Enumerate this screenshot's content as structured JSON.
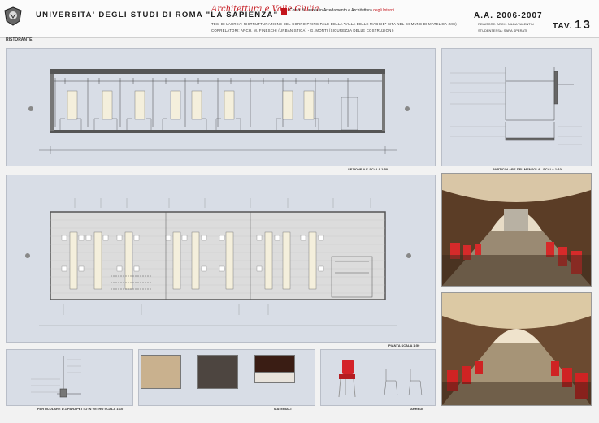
{
  "header": {
    "university": "UNIVERSITA' DEGLI STUDI DI ROMA \"LA SAPIENZA\"",
    "brand_script": "Architettura e Valle Giulia",
    "course_prefix": "Corso di Laurea in Arredamento e Architettura",
    "course_accent": "degli Interni",
    "thesis_line": "TESI DI LAUREA: RISTRUTTURAZIONE DEL CORPO PRINCIPALE DELLA \"VILLA DELLE MAGGIE\" SITA NEL COMUNE DI MATELICA (MC)",
    "correlatori_line": "CORRELATORI: ARCH. M. FINESCHI (URBANISTICA) - G. MONTI (SICUREZZA DELLE COSTRUZIONI)",
    "academic_year": "A.A. 2006-2007",
    "relatori": "RELATORE: ARCH. NILDA VALENTIN",
    "studenti": "STUDENTESSA: SARA SPERATI",
    "tav_label": "TAV.",
    "tav_number": "13"
  },
  "section_title": "RISTORANTE",
  "panels": {
    "sezione": "SEZIONE AA' SCALA 1:50",
    "mensola": "PARTICOLARE DEL MENSOLA - SCALA 1:10",
    "pianta": "PIANTA SCALA 1:50",
    "parapetto": "PARTICOLARE D.1 PARAPETTO IN VETRO SCALA 1:10",
    "materiali": "MATERIALI",
    "arredi": "ARREDI"
  },
  "colors": {
    "brand_red": "#c4151c",
    "panel_bg": "#d8dde6",
    "header_bg": "#fbfbfb"
  },
  "icons": {
    "logo": "sapienza-seal-icon",
    "section_marker": "section-arrow-icon"
  }
}
